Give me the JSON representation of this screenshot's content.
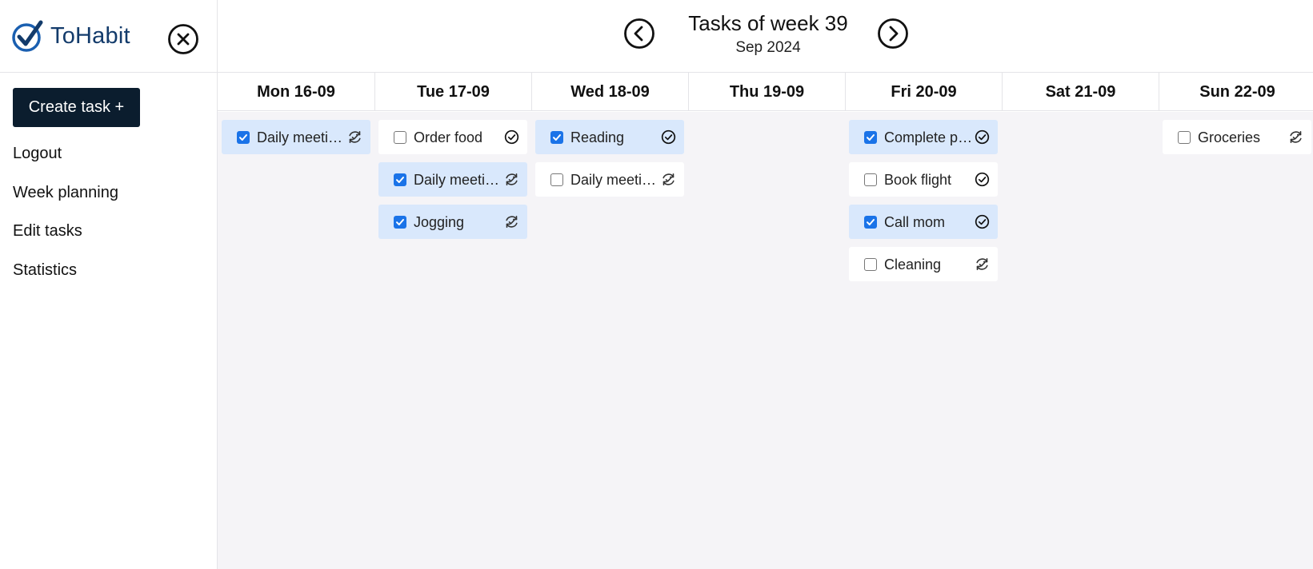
{
  "app": {
    "name": "ToHabit"
  },
  "sidebar": {
    "create_label": "Create task +",
    "items": [
      {
        "label": "Logout"
      },
      {
        "label": "Week planning"
      },
      {
        "label": "Edit tasks"
      },
      {
        "label": "Statistics"
      }
    ]
  },
  "header": {
    "title": "Tasks of week 39",
    "subtitle": "Sep 2024"
  },
  "days": [
    {
      "label": "Mon 16-09",
      "tasks": [
        {
          "name": "Daily meetings",
          "done": true,
          "kind": "recurring-icon"
        }
      ]
    },
    {
      "label": "Tue 17-09",
      "tasks": [
        {
          "name": "Order food",
          "done": false,
          "kind": "check-circle-icon"
        },
        {
          "name": "Daily meetings",
          "done": true,
          "kind": "recurring-icon"
        },
        {
          "name": "Jogging",
          "done": true,
          "kind": "recurring-icon"
        }
      ]
    },
    {
      "label": "Wed 18-09",
      "tasks": [
        {
          "name": "Reading",
          "done": true,
          "kind": "check-circle-icon"
        },
        {
          "name": "Daily meetings",
          "done": false,
          "kind": "recurring-icon"
        }
      ]
    },
    {
      "label": "Thu 19-09",
      "tasks": []
    },
    {
      "label": "Fri 20-09",
      "tasks": [
        {
          "name": "Complete project",
          "done": true,
          "kind": "check-circle-icon"
        },
        {
          "name": "Book flight",
          "done": false,
          "kind": "check-circle-icon"
        },
        {
          "name": "Call mom",
          "done": true,
          "kind": "check-circle-icon"
        },
        {
          "name": "Cleaning",
          "done": false,
          "kind": "recurring-icon"
        }
      ]
    },
    {
      "label": "Sat 21-09",
      "tasks": []
    },
    {
      "label": "Sun 22-09",
      "tasks": [
        {
          "name": "Groceries",
          "done": false,
          "kind": "recurring-icon"
        }
      ]
    }
  ],
  "colors": {
    "brand": "#133b6b",
    "button": "#0b1d2e",
    "done_bg": "#d9e8fc",
    "check": "#1a73e8",
    "grid_bg": "#f5f4f7"
  },
  "icons": {
    "logo": "checkmark-logo-icon",
    "close": "close-circle-icon",
    "prev": "chevron-left-circle-icon",
    "next": "chevron-right-circle-icon"
  }
}
